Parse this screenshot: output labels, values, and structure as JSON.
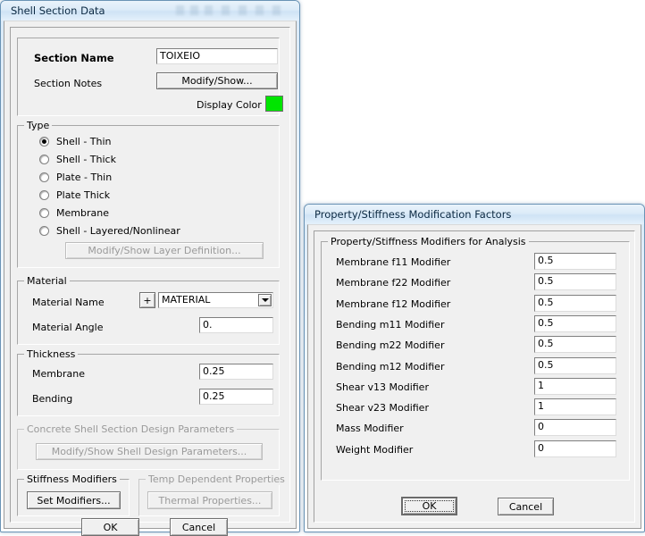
{
  "colors": {
    "display_color": "#00e500",
    "titlebar": "#dcebf8",
    "dialog_face": "#f0f0f0"
  },
  "shell_section_dialog": {
    "title": "Shell Section Data",
    "section_name_label": "Section Name",
    "section_name_value": "TOIXEIO",
    "section_notes_label": "Section Notes",
    "modify_show_notes_button": "Modify/Show...",
    "display_color_label": "Display Color",
    "type_group": {
      "legend": "Type",
      "options": [
        {
          "label": "Shell - Thin",
          "selected": true
        },
        {
          "label": "Shell - Thick",
          "selected": false
        },
        {
          "label": "Plate - Thin",
          "selected": false
        },
        {
          "label": "Plate Thick",
          "selected": false
        },
        {
          "label": "Membrane",
          "selected": false
        },
        {
          "label": "Shell - Layered/Nonlinear",
          "selected": false
        }
      ],
      "layer_definition_button": "Modify/Show Layer Definition..."
    },
    "material_group": {
      "legend": "Material",
      "material_name_label": "Material Name",
      "add_material_button": "+",
      "material_name_value": "MATERIAL",
      "material_angle_label": "Material Angle",
      "material_angle_value": "0."
    },
    "thickness_group": {
      "legend": "Thickness",
      "membrane_label": "Membrane",
      "membrane_value": "0.25",
      "bending_label": "Bending",
      "bending_value": "0.25"
    },
    "concrete_design_group": {
      "legend": "Concrete Shell Section Design Parameters",
      "button": "Modify/Show Shell Design Parameters..."
    },
    "stiffness_group": {
      "legend": "Stiffness Modifiers",
      "button": "Set Modifiers..."
    },
    "temp_group": {
      "legend": "Temp Dependent Properties",
      "button": "Thermal Properties..."
    },
    "ok_button": "OK",
    "cancel_button": "Cancel"
  },
  "modification_factors_dialog": {
    "title": "Property/Stiffness Modification Factors",
    "group_legend": "Property/Stiffness Modifiers for Analysis",
    "rows": [
      {
        "label": "Membrane f11 Modifier",
        "value": "0.5"
      },
      {
        "label": "Membrane f22 Modifier",
        "value": "0.5"
      },
      {
        "label": "Membrane f12 Modifier",
        "value": "0.5"
      },
      {
        "label": "Bending  m11 Modifier",
        "value": "0.5"
      },
      {
        "label": "Bending  m22 Modifier",
        "value": "0.5"
      },
      {
        "label": "Bending  m12 Modifier",
        "value": "0.5"
      },
      {
        "label": "Shear  v13 Modifier",
        "value": "1"
      },
      {
        "label": "Shear  v23 Modifier",
        "value": "1"
      },
      {
        "label": "Mass Modifier",
        "value": "0"
      },
      {
        "label": "Weight Modifier",
        "value": "0"
      }
    ],
    "ok_button": "OK",
    "cancel_button": "Cancel"
  }
}
